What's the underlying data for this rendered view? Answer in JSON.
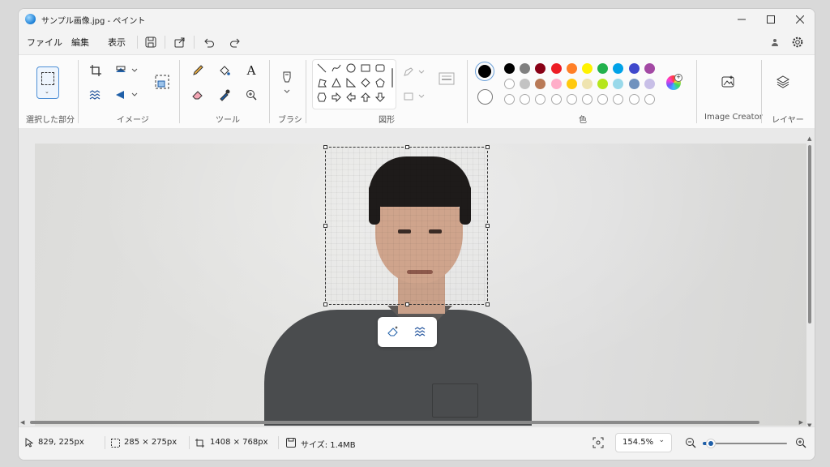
{
  "window": {
    "title": "サンプル画像.jpg - ペイント"
  },
  "menu": {
    "file": "ファイル",
    "edit": "編集",
    "view": "表示"
  },
  "ribbon": {
    "groups": {
      "selection": "選択した部分",
      "image": "イメージ",
      "tools": "ツール",
      "brushes": "ブラシ",
      "shapes": "図形",
      "colors": "色",
      "image_creator": "Image Creator",
      "layers": "レイヤー"
    },
    "palette_row1": [
      "#000000",
      "#7f7f7f",
      "#880015",
      "#ed1c24",
      "#ff7f27",
      "#fff200",
      "#22b14c",
      "#00a2e8",
      "#3f48cc",
      "#a349a4"
    ],
    "palette_row2": [
      "#ffffff",
      "#c3c3c3",
      "#b97a57",
      "#ffaec9",
      "#ffc90e",
      "#efe4b0",
      "#b5e61d",
      "#99d9ea",
      "#7092be",
      "#c8bfe7"
    ],
    "primary_color": "#000000",
    "secondary_color": "#ffffff"
  },
  "status": {
    "cursor": "829, 225px",
    "selection_size": "285 × 275px",
    "canvas_size": "1408 × 768px",
    "file_size": "サイズ: 1.4MB",
    "zoom": "154.5%",
    "zoom_slider_level": 0.1
  }
}
